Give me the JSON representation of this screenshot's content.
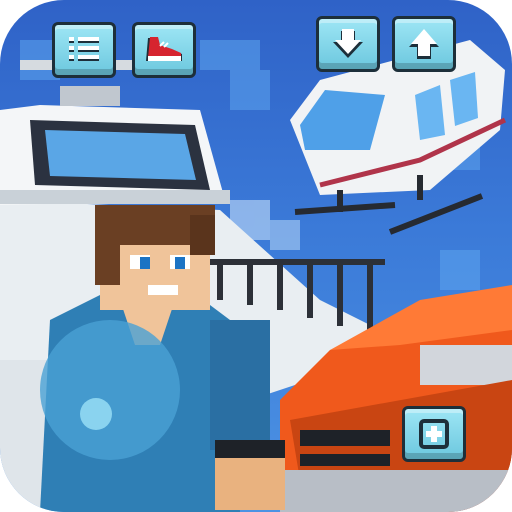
{
  "hud": {
    "menu_icon": "list-menu-icon",
    "sneaker_icon": "sneaker-icon",
    "descend_icon": "arrow-down-icon",
    "ascend_icon": "arrow-up-icon",
    "add_icon": "plus-icon"
  },
  "colors": {
    "sky": "#3b7ad8",
    "button_face": "#8adcef",
    "button_border": "#1d2f3a",
    "car_orange": "#f0591c",
    "player_shirt": "#2f7fb5"
  }
}
